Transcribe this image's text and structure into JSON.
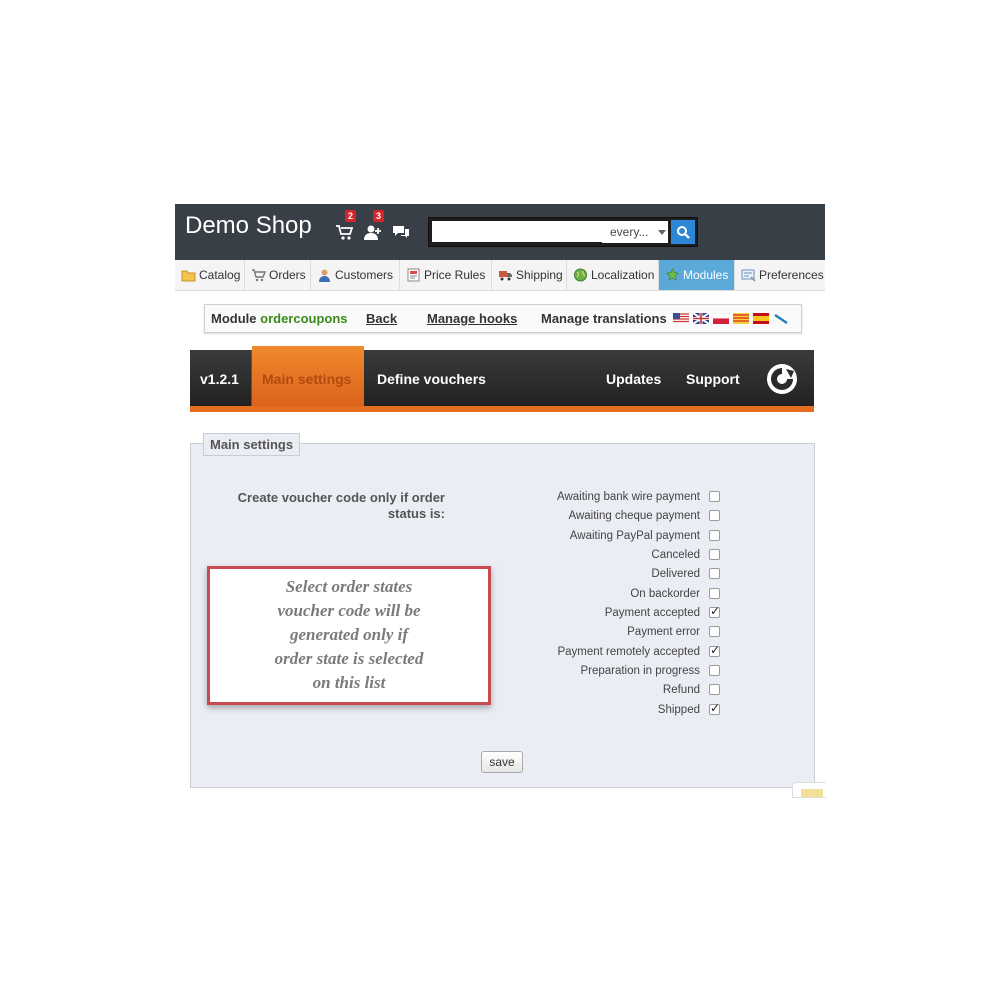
{
  "header": {
    "title": "Demo Shop",
    "cart_badge": "2",
    "customers_badge": "3",
    "search": {
      "value": "",
      "placeholder": "",
      "scope": "every..."
    }
  },
  "nav": {
    "tabs": [
      {
        "label": "Catalog",
        "icon": "folder-icon",
        "active": false
      },
      {
        "label": "Orders",
        "icon": "cart-icon",
        "active": false
      },
      {
        "label": "Customers",
        "icon": "user-icon",
        "active": false
      },
      {
        "label": "Price Rules",
        "icon": "price-tag-icon",
        "active": false
      },
      {
        "label": "Shipping",
        "icon": "truck-icon",
        "active": false
      },
      {
        "label": "Localization",
        "icon": "globe-icon",
        "active": false
      },
      {
        "label": "Modules",
        "icon": "puzzle-icon",
        "active": true
      },
      {
        "label": "Preferences",
        "icon": "preferences-icon",
        "active": false
      }
    ]
  },
  "module_bar": {
    "module_label": "Module",
    "module_name": "ordercoupons",
    "back": "Back",
    "manage_hooks": "Manage hooks",
    "manage_translations": "Manage translations",
    "flags": [
      "us-flag-icon",
      "uk-flag-icon",
      "pl-flag-icon",
      "catalan-flag-icon",
      "es-flag-icon",
      "edit-icon"
    ]
  },
  "module_header": {
    "version": "v1.2.1",
    "tabs": {
      "main_settings": "Main settings",
      "define_vouchers": "Define vouchers",
      "updates": "Updates",
      "support": "Support"
    }
  },
  "settings": {
    "legend": "Main settings",
    "question": "Create voucher code only if order status is:",
    "callout": [
      "Select order states",
      "voucher code will be",
      "generated only if",
      "order state is selected",
      "on this list"
    ],
    "options": [
      {
        "label": "Awaiting bank wire payment",
        "checked": false
      },
      {
        "label": "Awaiting cheque payment",
        "checked": false
      },
      {
        "label": "Awaiting PayPal payment",
        "checked": false
      },
      {
        "label": "Canceled",
        "checked": false
      },
      {
        "label": "Delivered",
        "checked": false
      },
      {
        "label": "On backorder",
        "checked": false
      },
      {
        "label": "Payment accepted",
        "checked": true
      },
      {
        "label": "Payment error",
        "checked": false
      },
      {
        "label": "Payment remotely accepted",
        "checked": true
      },
      {
        "label": "Preparation in progress",
        "checked": false
      },
      {
        "label": "Refund",
        "checked": false
      },
      {
        "label": "Shipped",
        "checked": true
      }
    ],
    "save": "save"
  },
  "colors": {
    "header_bg": "#383f46",
    "accent_orange": "#e46e1d",
    "active_tab": "#5aa9d9",
    "module_name": "#3b8a1a",
    "callout_border": "#c84b50"
  }
}
